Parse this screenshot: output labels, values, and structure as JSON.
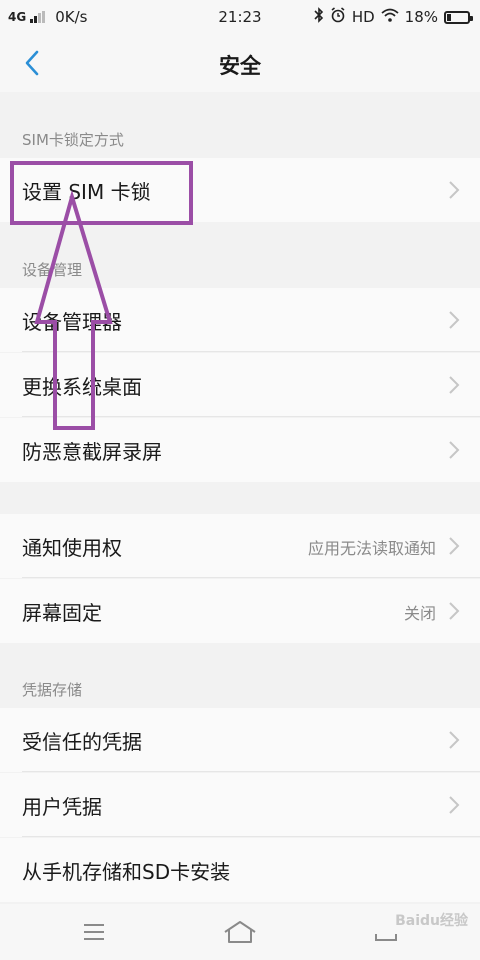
{
  "status_bar": {
    "network": "4G",
    "speed": "0K/s",
    "time": "21:23",
    "hd": "HD",
    "battery_text": "18%",
    "battery_level": 0.18
  },
  "header": {
    "title": "安全"
  },
  "sections": {
    "sim": {
      "header": "SIM卡锁定方式",
      "items": [
        {
          "label": "设置 SIM 卡锁"
        }
      ]
    },
    "device": {
      "header": "设备管理",
      "items": [
        {
          "label": "设备管理器"
        },
        {
          "label": "更换系统桌面"
        },
        {
          "label": "防恶意截屏录屏"
        }
      ]
    },
    "misc": {
      "items": [
        {
          "label": "通知使用权",
          "value": "应用无法读取通知"
        },
        {
          "label": "屏幕固定",
          "value": "关闭"
        }
      ]
    },
    "credentials": {
      "header": "凭据存储",
      "items": [
        {
          "label": "受信任的凭据"
        },
        {
          "label": "用户凭据"
        },
        {
          "label": "从手机存储和SD卡安装"
        }
      ]
    }
  },
  "watermark": "Baidu经验",
  "colors": {
    "accent": "#2b8fd6",
    "annotation": "#9b4ea6",
    "background": "#f2f2f2"
  }
}
